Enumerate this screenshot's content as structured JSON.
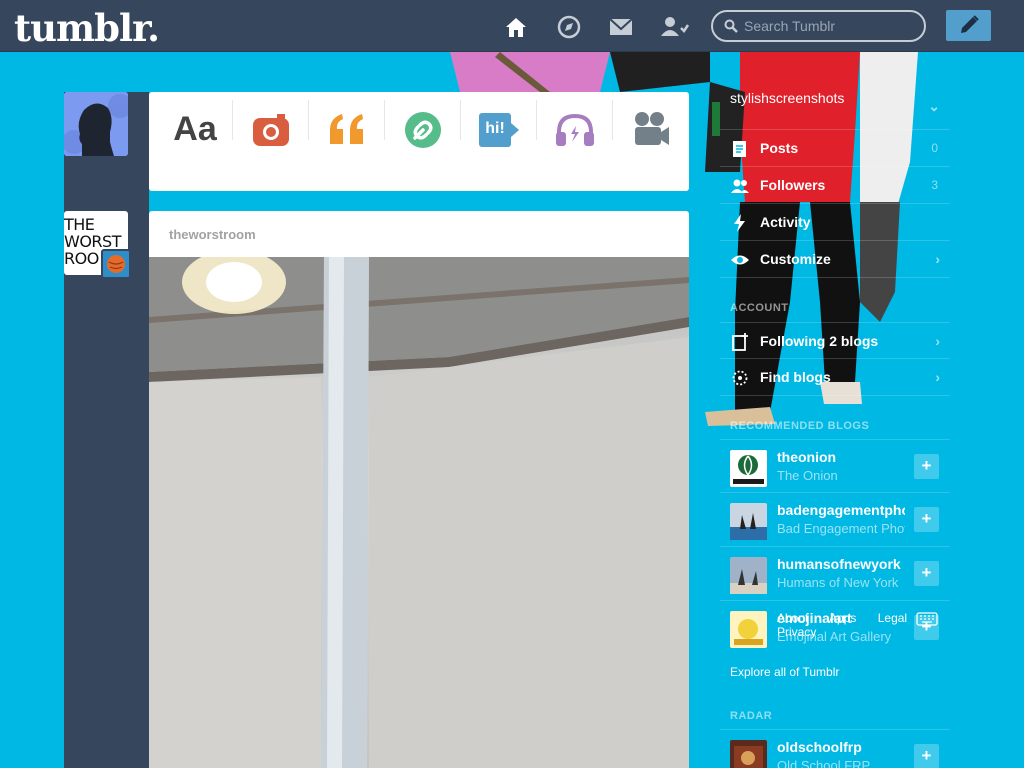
{
  "header": {
    "logo": "tumblr.",
    "search_placeholder": "Search Tumblr",
    "nav": [
      "home-icon",
      "explore-compass-icon",
      "inbox-mail-icon",
      "account-icon"
    ],
    "compose_icon": "pencil-icon"
  },
  "composer": {
    "types": [
      {
        "name": "text",
        "label": "Aa",
        "color": "#444444"
      },
      {
        "name": "photo",
        "color": "#d95e40"
      },
      {
        "name": "quote",
        "color": "#f2992e"
      },
      {
        "name": "link",
        "color": "#56bc8a"
      },
      {
        "name": "chat",
        "label": "hi!",
        "color": "#529ecc"
      },
      {
        "name": "audio",
        "color": "#a77dc2"
      },
      {
        "name": "video",
        "color": "#748089"
      }
    ]
  },
  "post": {
    "author": "theworstroom",
    "avatar_text": [
      "THE",
      "WORST",
      "ROO"
    ]
  },
  "sidebar": {
    "blog_name": "stylishscreenshots",
    "menu": [
      {
        "label": "Posts",
        "count": "0",
        "icon": "posts-icon"
      },
      {
        "label": "Followers",
        "count": "3",
        "icon": "followers-icon"
      },
      {
        "label": "Activity",
        "count": "",
        "icon": "activity-bolt-icon"
      },
      {
        "label": "Customize",
        "count": "",
        "icon": "eye-icon"
      }
    ],
    "account_heading": "ACCOUNT",
    "account_items": [
      {
        "label": "Following 2 blogs",
        "icon": "following-icon"
      },
      {
        "label": "Find blogs",
        "icon": "find-blogs-icon"
      }
    ],
    "recommended_heading": "RECOMMENDED BLOGS",
    "recommended": [
      {
        "name": "theonion",
        "title": "The Onion",
        "color": "#1b6b3a"
      },
      {
        "name": "badengagementphotos",
        "title": "Bad Engagement Photos",
        "color": "#c9d6e2"
      },
      {
        "name": "humansofnewyork",
        "title": "Humans of New York",
        "color": "#9fb2c8"
      },
      {
        "name": "emojinalart",
        "title": "Emojinal Art Gallery",
        "color": "#f2d23a"
      }
    ],
    "footer_links": [
      "About",
      "Apps",
      "Legal",
      "Privacy"
    ],
    "explore_link": "Explore all of Tumblr",
    "radar_heading": "RADAR",
    "radar": {
      "name": "oldschoolfrp",
      "title": "Old School FRP",
      "color": "#5a2a1e"
    }
  }
}
